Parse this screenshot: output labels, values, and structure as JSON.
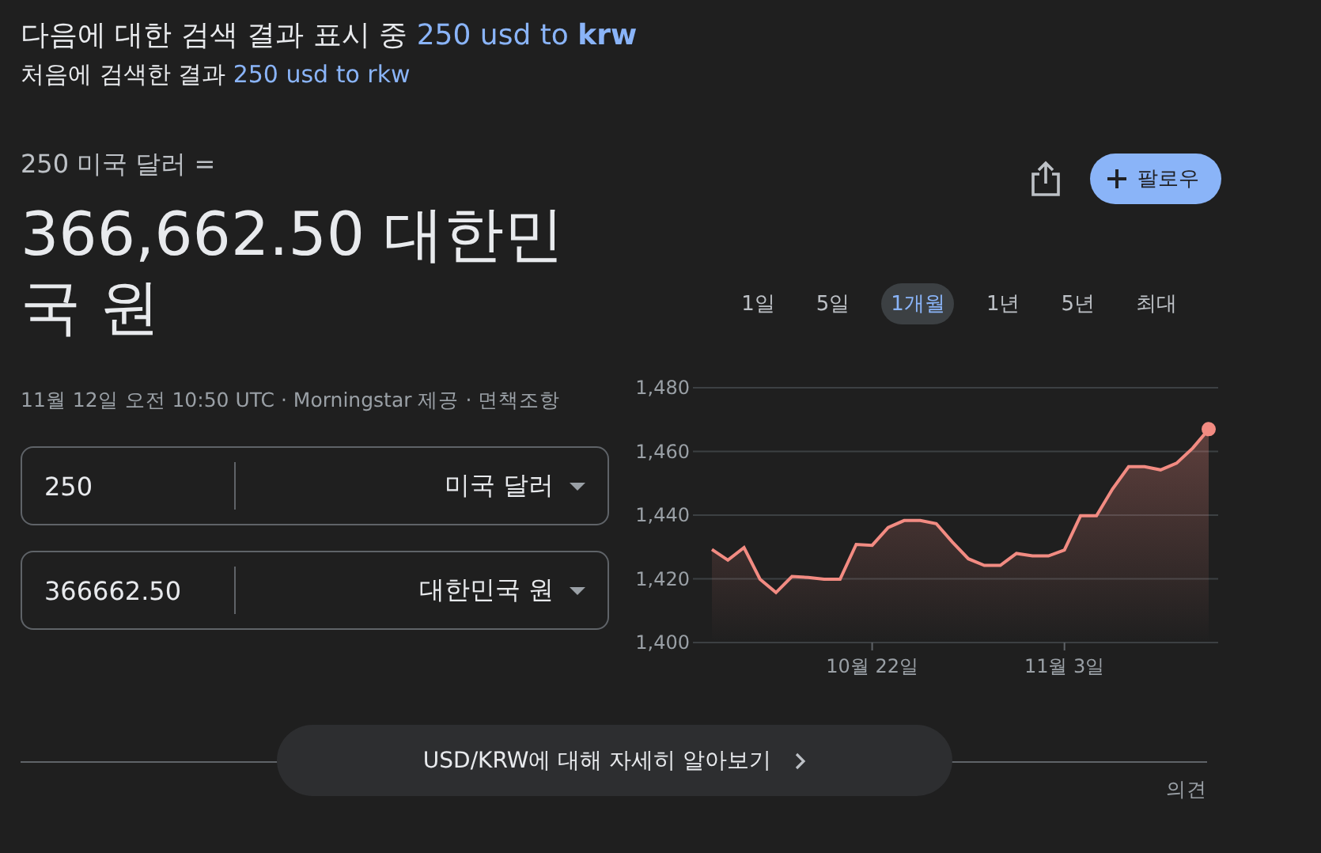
{
  "search_notice": {
    "prefix": "다음에 대한 검색 결과 표시 중",
    "link": "250 usd to **krw**"
  },
  "original_query": {
    "prefix": "처음에 검색한 결과",
    "link": "250 usd to rkw"
  },
  "result": {
    "from_text": "250 미국 달러 =",
    "amount": "366,662.50 대한민국 원",
    "source": "11월 12일 오전 10:50 UTC · Morningstar 제공 · 면책조항"
  },
  "follow_button": {
    "label": "팔로우"
  },
  "converter": [
    {
      "value": "250",
      "currency": "미국 달러"
    },
    {
      "value": "366662.50",
      "currency": "대한민국 원"
    }
  ],
  "ranges": [
    {
      "label": "1일",
      "selected": false
    },
    {
      "label": "5일",
      "selected": false
    },
    {
      "label": "1개월",
      "selected": true
    },
    {
      "label": "1년",
      "selected": false
    },
    {
      "label": "5년",
      "selected": false
    },
    {
      "label": "최대",
      "selected": false
    }
  ],
  "chart_data": {
    "type": "area",
    "categories": [
      null,
      null,
      null,
      null,
      null,
      null,
      null,
      null,
      null,
      null,
      "10월 22일",
      null,
      null,
      null,
      null,
      null,
      null,
      null,
      null,
      null,
      null,
      null,
      "11월 3일",
      null,
      null,
      null,
      null,
      null,
      null,
      null,
      null,
      null
    ],
    "series": [
      {
        "color": "#f28b82",
        "values": [
          1429.2,
          1425.9,
          1429.8,
          1419.9,
          1415.7,
          1420.7,
          1420.4,
          1419.9,
          1419.9,
          1430.8,
          1430.5,
          1436.1,
          1438.3,
          1438.3,
          1437.3,
          1431.6,
          1426.3,
          1424.2,
          1424.2,
          1428.0,
          1427.2,
          1427.2,
          1429.0,
          1439.8,
          1439.8,
          1448.2,
          1455.2,
          1455.2,
          1454.2,
          1456.3,
          1461.0,
          1467.0
        ]
      }
    ],
    "ylim": [
      1400,
      1480
    ],
    "grid": true,
    "yticks": [
      {
        "value": 1400,
        "label": "1,400"
      },
      {
        "value": 1420,
        "label": "1,420"
      },
      {
        "value": 1440,
        "label": "1,440"
      },
      {
        "value": 1460,
        "label": "1,460"
      },
      {
        "value": 1480,
        "label": "1,480"
      }
    ]
  },
  "more_button": {
    "label": "USD/KRW에 대해 자세히 알아보기"
  },
  "feedback_link": "의견"
}
